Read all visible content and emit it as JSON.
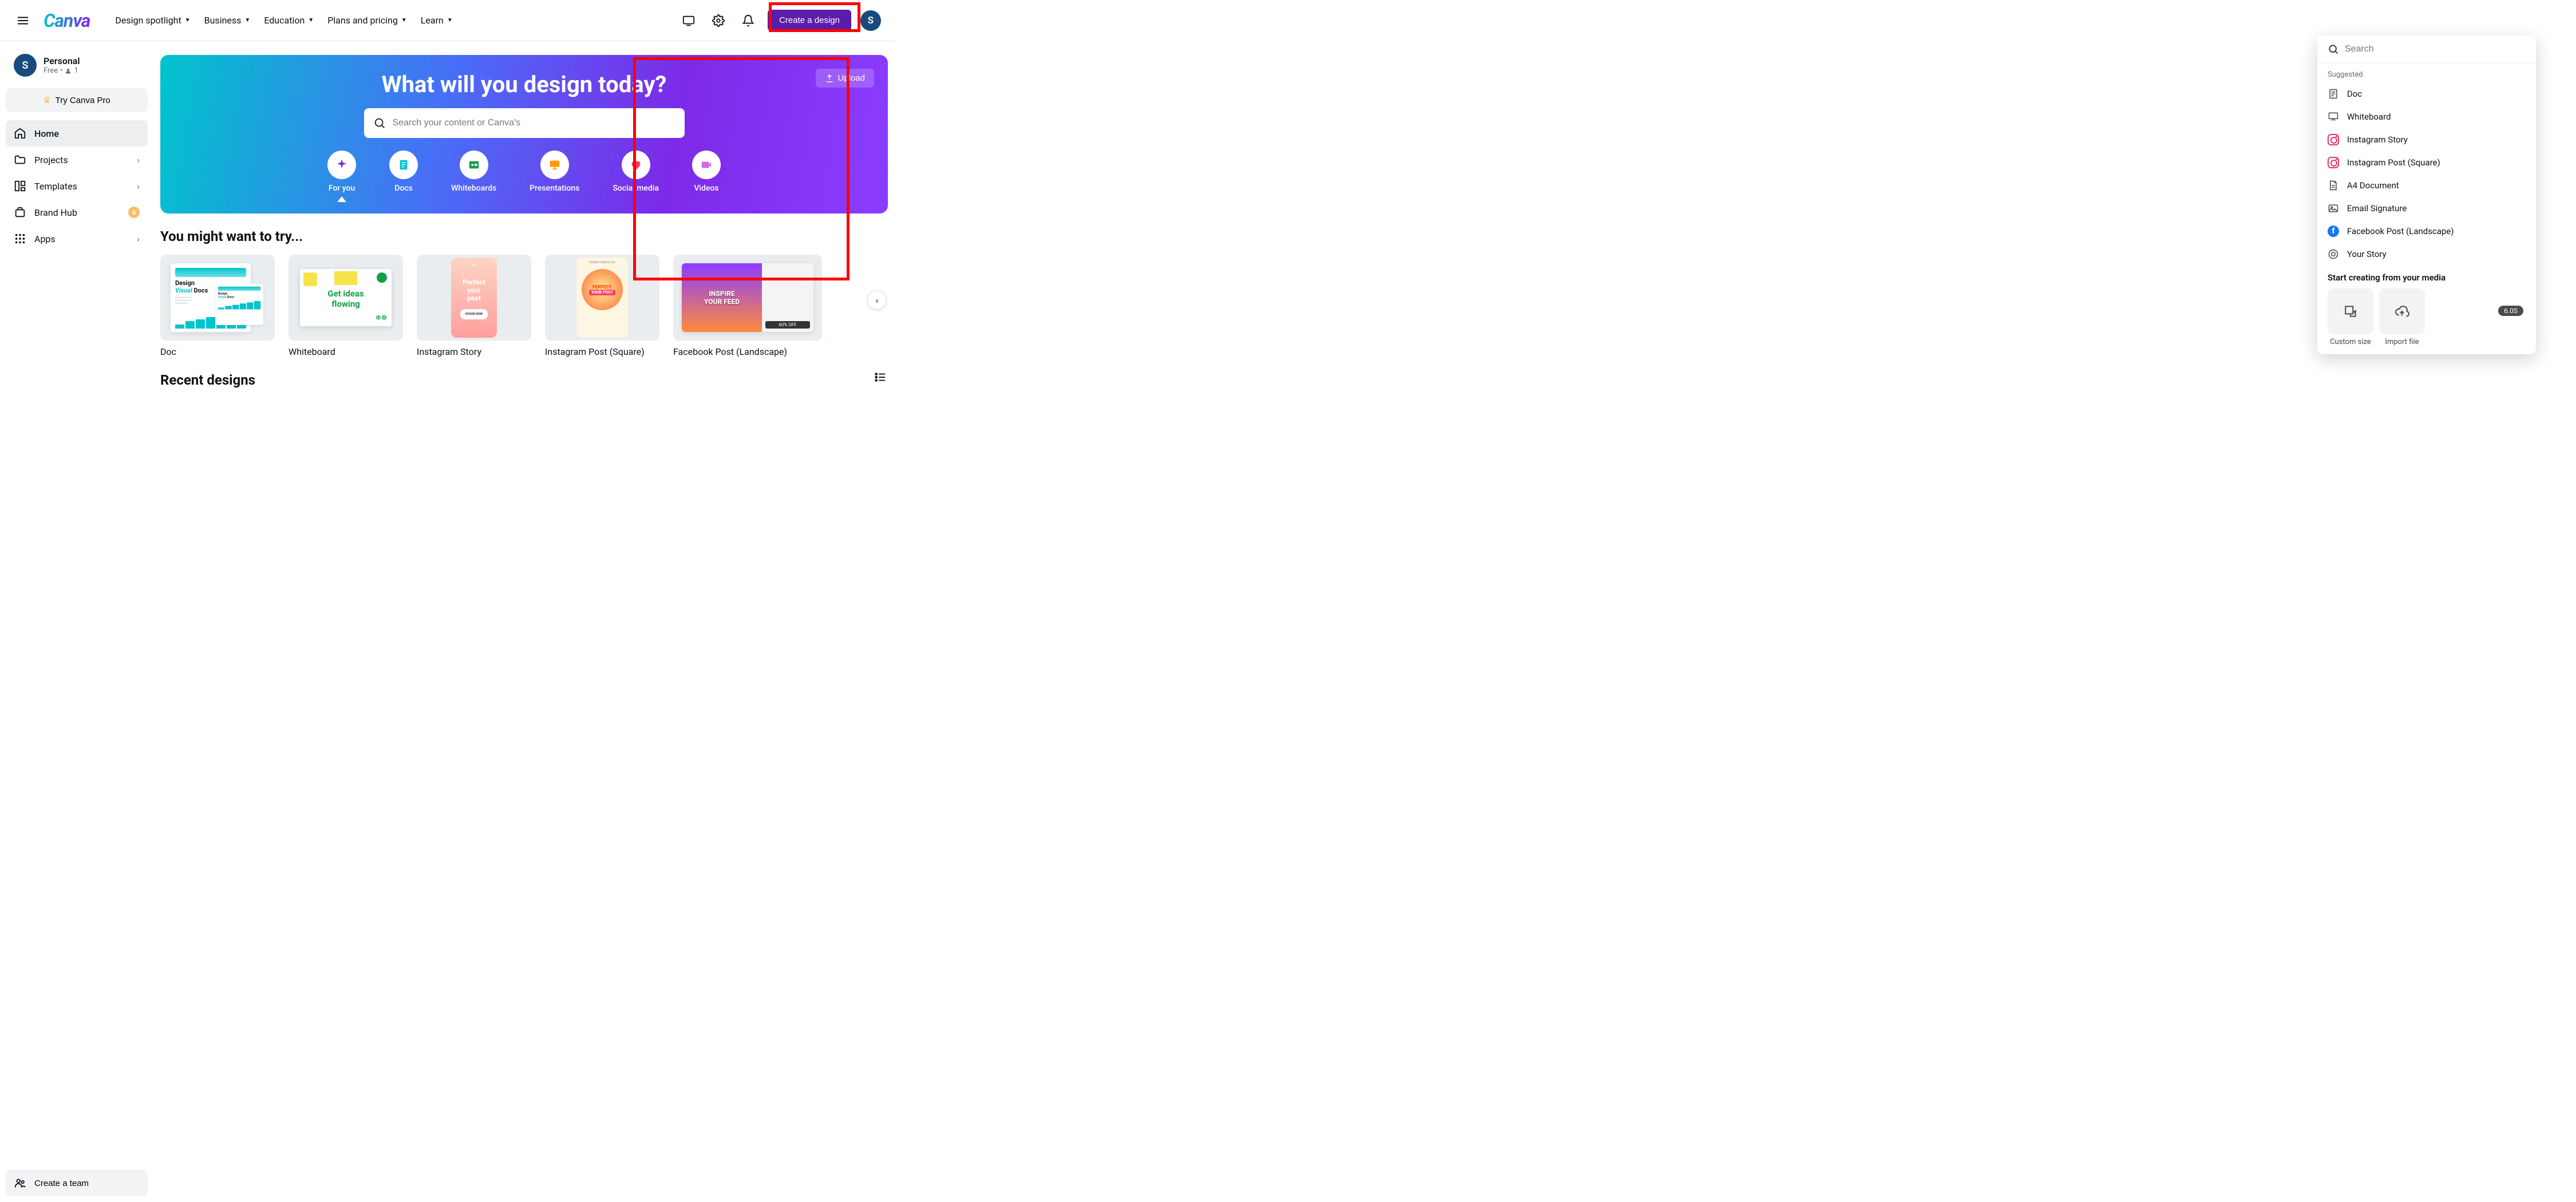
{
  "topnav": {
    "logo": "Canva",
    "items": [
      "Design spotlight",
      "Business",
      "Education",
      "Plans and pricing",
      "Learn"
    ],
    "create_label": "Create a design",
    "avatar_initial": "S"
  },
  "sidebar": {
    "account_name": "Personal",
    "account_plan": "Free",
    "account_members": "1",
    "try_pro": "Try Canva Pro",
    "items": [
      {
        "label": "Home",
        "icon": "home",
        "active": true
      },
      {
        "label": "Projects",
        "icon": "folder",
        "chevron": true
      },
      {
        "label": "Templates",
        "icon": "templates",
        "chevron": true
      },
      {
        "label": "Brand Hub",
        "icon": "brand",
        "badge": true
      },
      {
        "label": "Apps",
        "icon": "apps",
        "chevron": true
      }
    ],
    "create_team": "Create a team"
  },
  "hero": {
    "title": "What will you design today?",
    "search_placeholder": "Search your content or Canva's",
    "upload_label": "Upload",
    "categories": [
      "For you",
      "Docs",
      "Whiteboards",
      "Presentations",
      "Social media",
      "Videos"
    ]
  },
  "try": {
    "title": "You might want to try...",
    "cards": [
      "Doc",
      "Whiteboard",
      "Instagram Story",
      "Instagram Post (Square)",
      "Facebook Post (Landscape)"
    ]
  },
  "recent": {
    "title": "Recent designs"
  },
  "dropdown": {
    "search_placeholder": "Search",
    "suggested_label": "Suggested",
    "items": [
      {
        "label": "Doc",
        "icon": "doc"
      },
      {
        "label": "Whiteboard",
        "icon": "whiteboard"
      },
      {
        "label": "Instagram Story",
        "icon": "instagram"
      },
      {
        "label": "Instagram Post (Square)",
        "icon": "instagram"
      },
      {
        "label": "A4 Document",
        "icon": "doc"
      },
      {
        "label": "Email Signature",
        "icon": "image"
      },
      {
        "label": "Facebook Post (Landscape)",
        "icon": "facebook"
      },
      {
        "label": "Your Story",
        "icon": "story"
      }
    ],
    "media_label": "Start creating from your media",
    "media_tiles": [
      {
        "label": "Custom size",
        "icon": "resize"
      },
      {
        "label": "Import file",
        "icon": "upload"
      }
    ],
    "pill": "6.0S"
  },
  "doc_thumb": {
    "line1": "Design",
    "line2_em": "Visual",
    "line2_rest": " Docs"
  },
  "whiteboard_thumb": {
    "line1": "Get ideas",
    "line2": "flowing"
  },
  "story_thumb": {
    "line1": "Perfect",
    "line2": "your",
    "line3": "post",
    "btn": "DESIGN NOW"
  },
  "post_thumb": {
    "tiny": "SHARE YOUR STYLE",
    "badge1": "PERFECT",
    "badge2": "YOUR POST"
  },
  "fb_thumb": {
    "line1": "INSPIRE",
    "line2": "YOUR FEED",
    "sale": "60% OFF"
  }
}
